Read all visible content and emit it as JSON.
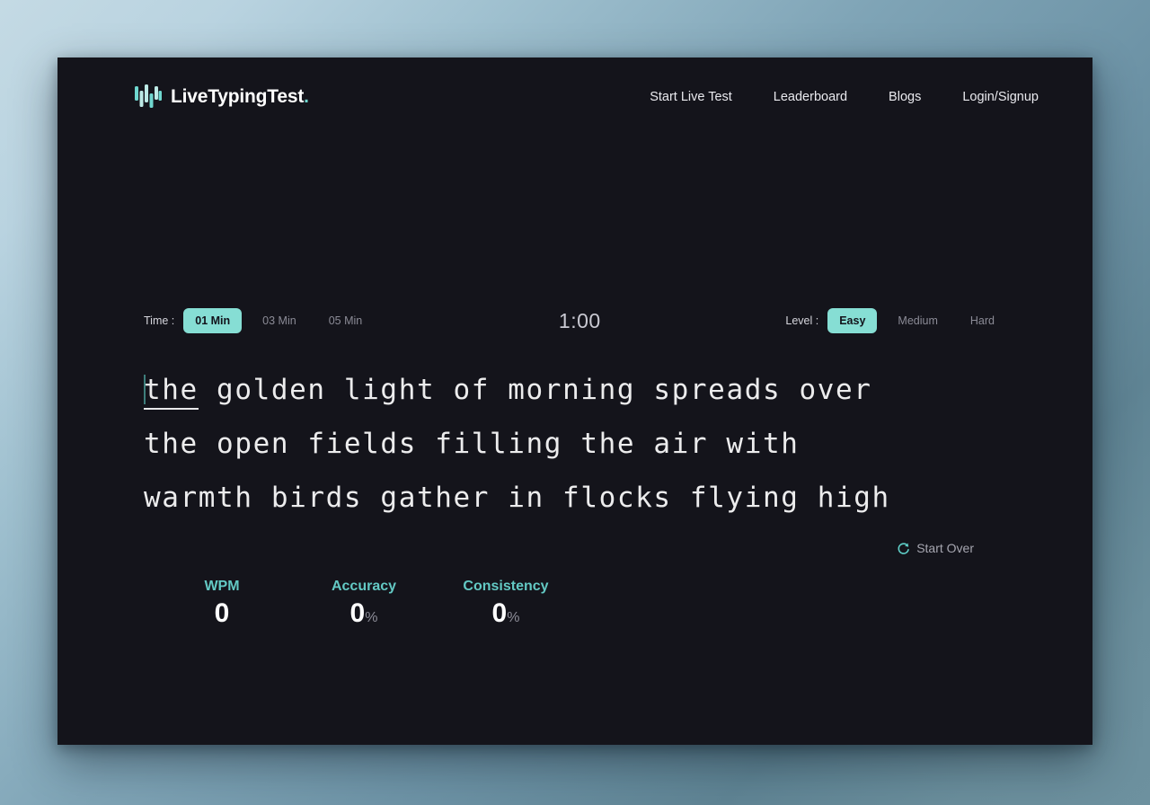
{
  "brand": {
    "name": "LiveTypingTest",
    "dot": ".",
    "logo_icon": "equalizer-bars-icon",
    "accent_color": "#6fd7cf"
  },
  "nav": {
    "items": [
      {
        "label": "Start Live Test",
        "name": "nav-start-live-test"
      },
      {
        "label": "Leaderboard",
        "name": "nav-leaderboard"
      },
      {
        "label": "Blogs",
        "name": "nav-blogs"
      },
      {
        "label": "Login/Signup",
        "name": "nav-login-signup"
      }
    ]
  },
  "controls": {
    "time_label": "Time :",
    "time_options": [
      {
        "label": "01 Min",
        "selected": true
      },
      {
        "label": "03 Min",
        "selected": false
      },
      {
        "label": "05 Min",
        "selected": false
      }
    ],
    "timer": "1:00",
    "level_label": "Level :",
    "level_options": [
      {
        "label": "Easy",
        "selected": true
      },
      {
        "label": "Medium",
        "selected": false
      },
      {
        "label": "Hard",
        "selected": false
      }
    ],
    "selected_color": "#86ded4"
  },
  "passage": {
    "current_word": "the",
    "rest": " golden light of morning spreads over\nthe open fields filling the air with\nwarmth birds gather in flocks flying high",
    "full_text": "the golden light of morning spreads over the open fields filling the air with warmth birds gather in flocks flying high",
    "caret_color": "#3e7f7c"
  },
  "restart": {
    "label": "Start Over",
    "icon": "refresh-icon"
  },
  "stats": [
    {
      "label": "WPM",
      "value": "0",
      "unit": ""
    },
    {
      "label": "Accuracy",
      "value": "0",
      "unit": "%"
    },
    {
      "label": "Consistency",
      "value": "0",
      "unit": "%"
    }
  ]
}
